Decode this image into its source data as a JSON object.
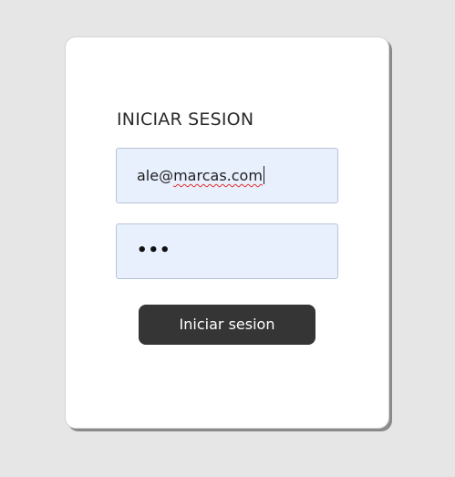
{
  "login_card": {
    "title": "INICIAR SESION",
    "email_field": {
      "prefix": "ale@",
      "value_misspelled": "marcas.com"
    },
    "password_field": {
      "masked_value": "•••"
    },
    "submit_label": "Iniciar sesion"
  },
  "colors": {
    "page_background": "#e6e6e6",
    "card_background": "#ffffff",
    "input_background": "#e8f0fe",
    "button_background": "#353535",
    "button_text": "#ffffff"
  }
}
